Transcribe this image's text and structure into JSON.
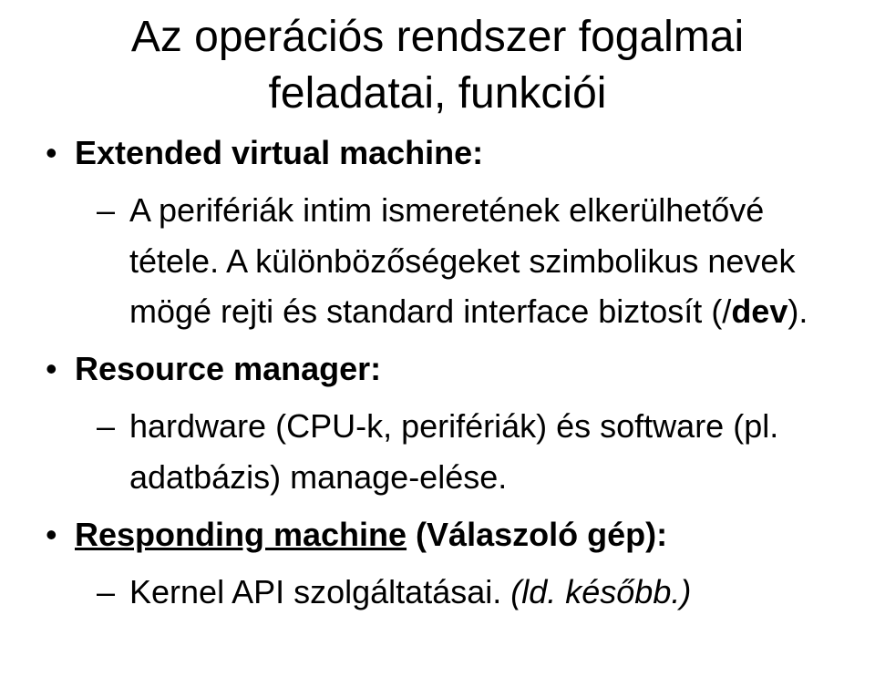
{
  "title_line1": "Az operációs rendszer fogalmai",
  "title_line2": "feladatai, funkciói",
  "items": [
    {
      "label": "Extended virtual machine:",
      "sub": [
        {
          "prefix": "A perifériák intim ismeretének elkerülhetővé tétele. A különbözőségeket szimbolikus nevek mögé rejti és standard interface biztosít (/",
          "bold_part": "dev",
          "suffix": ")."
        }
      ]
    },
    {
      "label": "Resource manager:",
      "sub": [
        {
          "prefix": "hardware (CPU-k, perifériák) és software (pl. adatbázis) manage-elése.",
          "bold_part": "",
          "suffix": ""
        }
      ]
    },
    {
      "label_prefix": "Responding machine",
      "label_suffix": " (Válaszoló gép):",
      "sub": [
        {
          "prefix": "Kernel API szolgáltatásai. ",
          "italic_part": "(ld. később.)",
          "suffix": ""
        }
      ]
    }
  ]
}
